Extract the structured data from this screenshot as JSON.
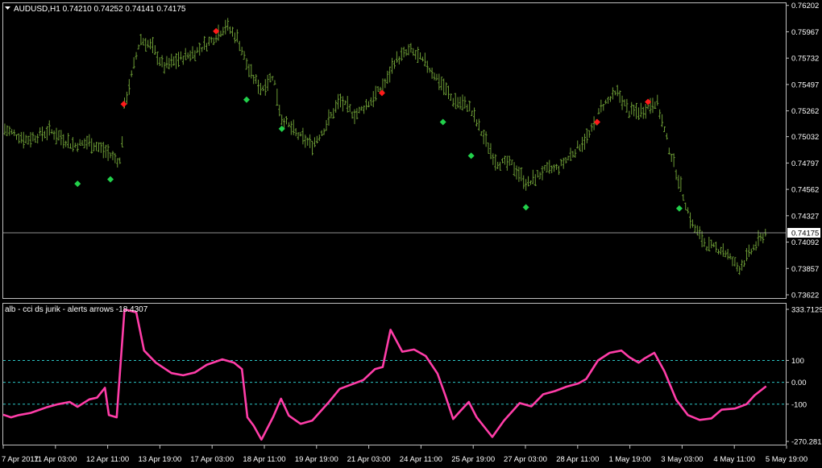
{
  "chart_data": [
    {
      "type": "bar",
      "subtype": "ohlc-price",
      "title": "AUDUSD,H1  0.74210 0.74252 0.74141 0.74175",
      "symbol": "AUDUSD,H1",
      "quote": {
        "open": "0.74210",
        "high": "0.74252",
        "low": "0.74141",
        "close": "0.74175"
      },
      "ylim": [
        0.73622,
        0.762
      ],
      "y_ticks": [
        "0.76202",
        "0.75967",
        "0.75732",
        "0.75497",
        "0.75262",
        "0.75032",
        "0.74797",
        "0.74562",
        "0.74327",
        "0.74092",
        "0.73857",
        "0.73622"
      ],
      "current_price_label": "0.74175",
      "current_price": 0.74175,
      "bar_color": "#6b9a35",
      "x_index_range": [
        0,
        1000
      ],
      "price_path": [
        [
          0,
          0.751
        ],
        [
          30,
          0.75
        ],
        [
          60,
          0.7508
        ],
        [
          90,
          0.7495
        ],
        [
          110,
          0.7498
        ],
        [
          130,
          0.749
        ],
        [
          150,
          0.748
        ],
        [
          155,
          0.753
        ],
        [
          165,
          0.756
        ],
        [
          175,
          0.759
        ],
        [
          190,
          0.7583
        ],
        [
          205,
          0.7565
        ],
        [
          225,
          0.7572
        ],
        [
          245,
          0.7578
        ],
        [
          265,
          0.7588
        ],
        [
          285,
          0.7602
        ],
        [
          300,
          0.759
        ],
        [
          315,
          0.756
        ],
        [
          330,
          0.7545
        ],
        [
          345,
          0.7558
        ],
        [
          355,
          0.752
        ],
        [
          375,
          0.7505
        ],
        [
          395,
          0.7495
        ],
        [
          410,
          0.751
        ],
        [
          430,
          0.7535
        ],
        [
          450,
          0.7522
        ],
        [
          470,
          0.7535
        ],
        [
          490,
          0.7552
        ],
        [
          500,
          0.757
        ],
        [
          520,
          0.758
        ],
        [
          540,
          0.7568
        ],
        [
          560,
          0.755
        ],
        [
          575,
          0.7535
        ],
        [
          595,
          0.753
        ],
        [
          610,
          0.7508
        ],
        [
          630,
          0.748
        ],
        [
          650,
          0.7478
        ],
        [
          670,
          0.746
        ],
        [
          690,
          0.7472
        ],
        [
          710,
          0.7475
        ],
        [
          730,
          0.749
        ],
        [
          750,
          0.7505
        ],
        [
          765,
          0.753
        ],
        [
          785,
          0.7542
        ],
        [
          800,
          0.7525
        ],
        [
          815,
          0.7525
        ],
        [
          835,
          0.7535
        ],
        [
          850,
          0.7495
        ],
        [
          865,
          0.746
        ],
        [
          880,
          0.7425
        ],
        [
          900,
          0.7405
        ],
        [
          920,
          0.7402
        ],
        [
          940,
          0.7385
        ],
        [
          955,
          0.74
        ],
        [
          975,
          0.7418
        ]
      ],
      "buy_arrows": [
        [
          95,
          0.74612
        ],
        [
          137,
          0.74652
        ],
        [
          311,
          0.75362
        ],
        [
          356,
          0.75102
        ],
        [
          562,
          0.75162
        ],
        [
          598,
          0.74862
        ],
        [
          668,
          0.74402
        ],
        [
          864,
          0.74392
        ]
      ],
      "sell_arrows": [
        [
          154,
          0.75322
        ],
        [
          272,
          0.75972
        ],
        [
          484,
          0.75422
        ],
        [
          759,
          0.75162
        ],
        [
          824,
          0.75342
        ]
      ],
      "buy_color": "#22d04b",
      "sell_color": "#ff1a1a"
    },
    {
      "type": "line",
      "title": "alb - cci ds jurik - alerts arrows -18.4307",
      "ylim": [
        -270.2815,
        333.7129
      ],
      "y_ticks": [
        "333.7129",
        "100",
        "0.00",
        "-100",
        "-270.2815"
      ],
      "levels": [
        100,
        0,
        -100
      ],
      "x_index_range": [
        0,
        1000
      ],
      "line_color": "#ff3da8",
      "series": [
        {
          "values": [
            [
              0,
              -148
            ],
            [
              10,
              -160
            ],
            [
              20,
              -150
            ],
            [
              35,
              -140
            ],
            [
              55,
              -115
            ],
            [
              70,
              -100
            ],
            [
              85,
              -90
            ],
            [
              95,
              -112
            ],
            [
              110,
              -78
            ],
            [
              120,
              -70
            ],
            [
              130,
              -25
            ],
            [
              135,
              -150
            ],
            [
              145,
              -160
            ],
            [
              155,
              333
            ],
            [
              170,
              320
            ],
            [
              180,
              145
            ],
            [
              195,
              90
            ],
            [
              215,
              42
            ],
            [
              230,
              32
            ],
            [
              245,
              45
            ],
            [
              260,
              80
            ],
            [
              280,
              105
            ],
            [
              295,
              90
            ],
            [
              305,
              60
            ],
            [
              312,
              -160
            ],
            [
              320,
              -198
            ],
            [
              330,
              -262
            ],
            [
              345,
              -158
            ],
            [
              355,
              -75
            ],
            [
              365,
              -152
            ],
            [
              380,
              -190
            ],
            [
              395,
              -175
            ],
            [
              415,
              -95
            ],
            [
              430,
              -30
            ],
            [
              445,
              -10
            ],
            [
              460,
              10
            ],
            [
              475,
              60
            ],
            [
              485,
              70
            ],
            [
              495,
              240
            ],
            [
              510,
              140
            ],
            [
              525,
              150
            ],
            [
              540,
              120
            ],
            [
              555,
              40
            ],
            [
              565,
              -60
            ],
            [
              575,
              -168
            ],
            [
              585,
              -128
            ],
            [
              595,
              -90
            ],
            [
              605,
              -160
            ],
            [
              625,
              -250
            ],
            [
              640,
              -175
            ],
            [
              660,
              -95
            ],
            [
              675,
              -110
            ],
            [
              690,
              -55
            ],
            [
              705,
              -40
            ],
            [
              720,
              -20
            ],
            [
              735,
              -5
            ],
            [
              745,
              15
            ],
            [
              760,
              100
            ],
            [
              775,
              135
            ],
            [
              790,
              145
            ],
            [
              800,
              115
            ],
            [
              812,
              90
            ],
            [
              820,
              110
            ],
            [
              832,
              135
            ],
            [
              845,
              50
            ],
            [
              860,
              -80
            ],
            [
              875,
              -150
            ],
            [
              890,
              -172
            ],
            [
              905,
              -165
            ],
            [
              918,
              -125
            ],
            [
              935,
              -120
            ],
            [
              950,
              -100
            ],
            [
              960,
              -60
            ],
            [
              975,
              -18
            ]
          ]
        }
      ]
    }
  ],
  "time_axis": [
    "7 Apr 2017",
    "11 Apr 03:00",
    "12 Apr 11:00",
    "13 Apr 19:00",
    "17 Apr 03:00",
    "18 Apr 11:00",
    "19 Apr 19:00",
    "21 Apr 03:00",
    "24 Apr 11:00",
    "25 Apr 19:00",
    "27 Apr 03:00",
    "28 Apr 11:00",
    "1 May 19:00",
    "3 May 03:00",
    "4 May 11:00",
    "5 May 19:00"
  ],
  "colors": {
    "background": "#000000",
    "grid_border": "#c0c0c0",
    "level_line": "#2cc5c5",
    "text": "#ffffff"
  }
}
